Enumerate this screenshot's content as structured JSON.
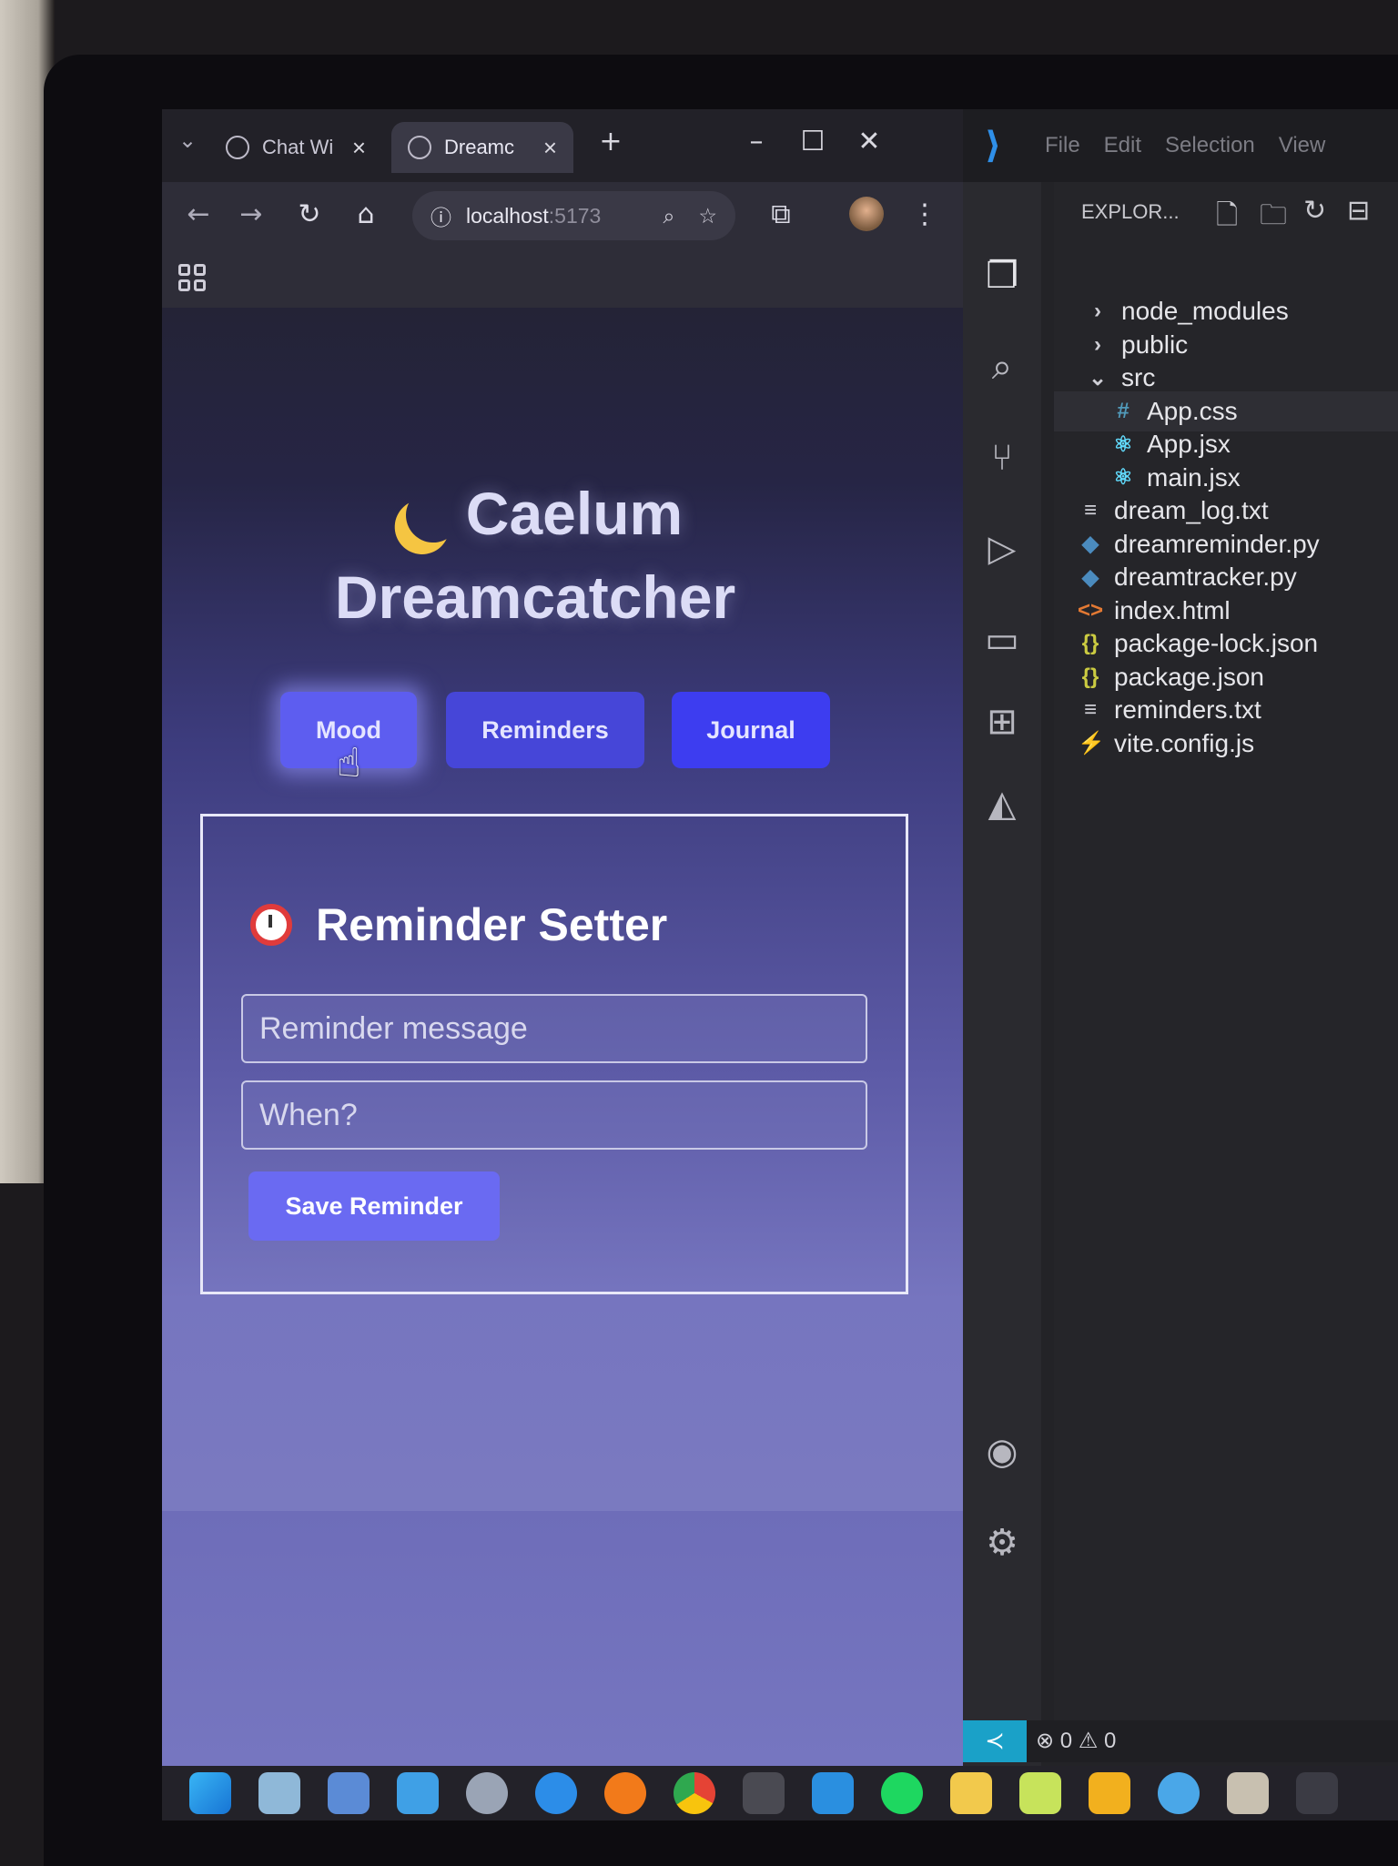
{
  "browser": {
    "tabs": [
      {
        "label": "Chat Wi",
        "active": false
      },
      {
        "label": "Dreamc",
        "active": true
      }
    ],
    "new_tab": "+",
    "url_host": "localhost",
    "url_port": ":5173"
  },
  "app": {
    "title_line1": "Caelum",
    "title_line2": "Dreamcatcher",
    "nav": {
      "mood": "Mood",
      "reminders": "Reminders",
      "journal": "Journal"
    },
    "reminder_setter": {
      "title": "Reminder Setter",
      "message_placeholder": "Reminder message",
      "when_placeholder": "When?",
      "save_label": "Save Reminder"
    },
    "colors": {
      "accent": "#4848e6",
      "moon": "#f5c542",
      "clock": "#e03b3b"
    }
  },
  "vscode": {
    "menu": [
      "File",
      "Edit",
      "Selection",
      "View"
    ],
    "explorer_title": "EXPLOR...",
    "tree": [
      {
        "name": "node_modules",
        "kind": "folder",
        "icon": "chevron-right",
        "depth": 0
      },
      {
        "name": "public",
        "kind": "folder",
        "icon": "chevron-right",
        "depth": 0
      },
      {
        "name": "src",
        "kind": "folder",
        "icon": "chevron-down",
        "depth": 0
      },
      {
        "name": "App.css",
        "kind": "css",
        "icon": "#",
        "depth": 1
      },
      {
        "name": "App.jsx",
        "kind": "react",
        "icon": "⚛",
        "depth": 1
      },
      {
        "name": "main.jsx",
        "kind": "react",
        "icon": "⚛",
        "depth": 1
      },
      {
        "name": "dream_log.txt",
        "kind": "text",
        "icon": "≡",
        "depth": 0
      },
      {
        "name": "dreamreminder.py",
        "kind": "python",
        "icon": "◆",
        "depth": 0
      },
      {
        "name": "dreamtracker.py",
        "kind": "python",
        "icon": "◆",
        "depth": 0
      },
      {
        "name": "index.html",
        "kind": "html",
        "icon": "<>",
        "depth": 0
      },
      {
        "name": "package-lock.json",
        "kind": "json",
        "icon": "{}",
        "depth": 0
      },
      {
        "name": "package.json",
        "kind": "json",
        "icon": "{}",
        "depth": 0
      },
      {
        "name": "reminders.txt",
        "kind": "text",
        "icon": "≡",
        "depth": 0
      },
      {
        "name": "vite.config.js",
        "kind": "vite",
        "icon": "⚡",
        "depth": 0
      }
    ],
    "status": {
      "errors": "0",
      "warnings": "0"
    }
  }
}
